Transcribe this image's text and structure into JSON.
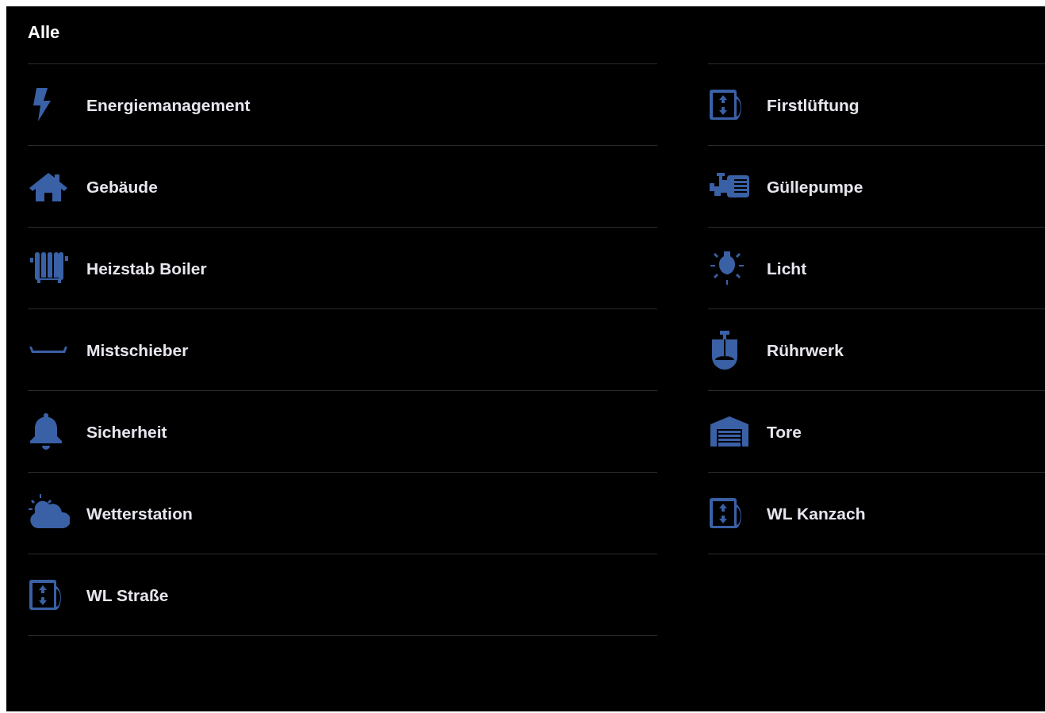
{
  "title": "Alle",
  "columns": [
    {
      "items": [
        {
          "label": "Energiemanagement",
          "kind": "bolt"
        },
        {
          "label": "Gebäude",
          "kind": "house"
        },
        {
          "label": "Heizstab Boiler",
          "kind": "radiator"
        },
        {
          "label": "Mistschieber",
          "kind": "scraper"
        },
        {
          "label": "Sicherheit",
          "kind": "bell"
        },
        {
          "label": "Wetterstation",
          "kind": "weather"
        },
        {
          "label": "WL Straße",
          "kind": "fan"
        }
      ]
    },
    {
      "items": [
        {
          "label": "Firstlüftung",
          "kind": "fan"
        },
        {
          "label": "Güllepumpe",
          "kind": "pump"
        },
        {
          "label": "Licht",
          "kind": "bulb"
        },
        {
          "label": "Rührwerk",
          "kind": "stirrer"
        },
        {
          "label": "Tore",
          "kind": "garage"
        },
        {
          "label": "WL Kanzach",
          "kind": "fan"
        }
      ]
    }
  ]
}
